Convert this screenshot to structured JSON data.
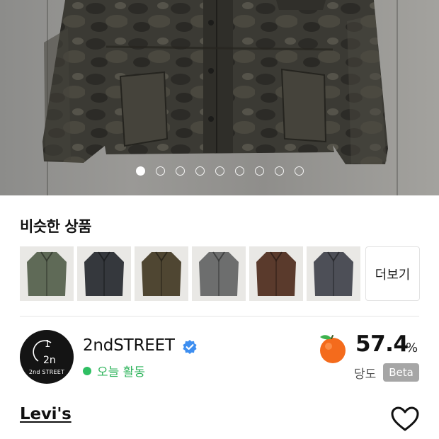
{
  "gallery": {
    "image_alt": "camouflage field jacket",
    "dot_count": 9,
    "active_index": 0
  },
  "similar": {
    "title": "비슷한 상품",
    "items": [
      {
        "color": "#5f6a57"
      },
      {
        "color": "#35383d"
      },
      {
        "color": "#4f4632"
      },
      {
        "color": "#6d6e6e"
      },
      {
        "color": "#5a3a2c"
      },
      {
        "color": "#4d4f57"
      }
    ],
    "more_label": "더보기"
  },
  "seller": {
    "name": "2ndSTREET",
    "avatar_text": "2nd STREET",
    "status": "오늘 활동",
    "status_color": "#2fbf63",
    "verified_color": "#3d8ef0"
  },
  "score": {
    "value": "57.4",
    "unit": "%",
    "label": "당도",
    "badge": "Beta",
    "icon": "orange-fruit-icon"
  },
  "product": {
    "brand": "Levi's"
  }
}
